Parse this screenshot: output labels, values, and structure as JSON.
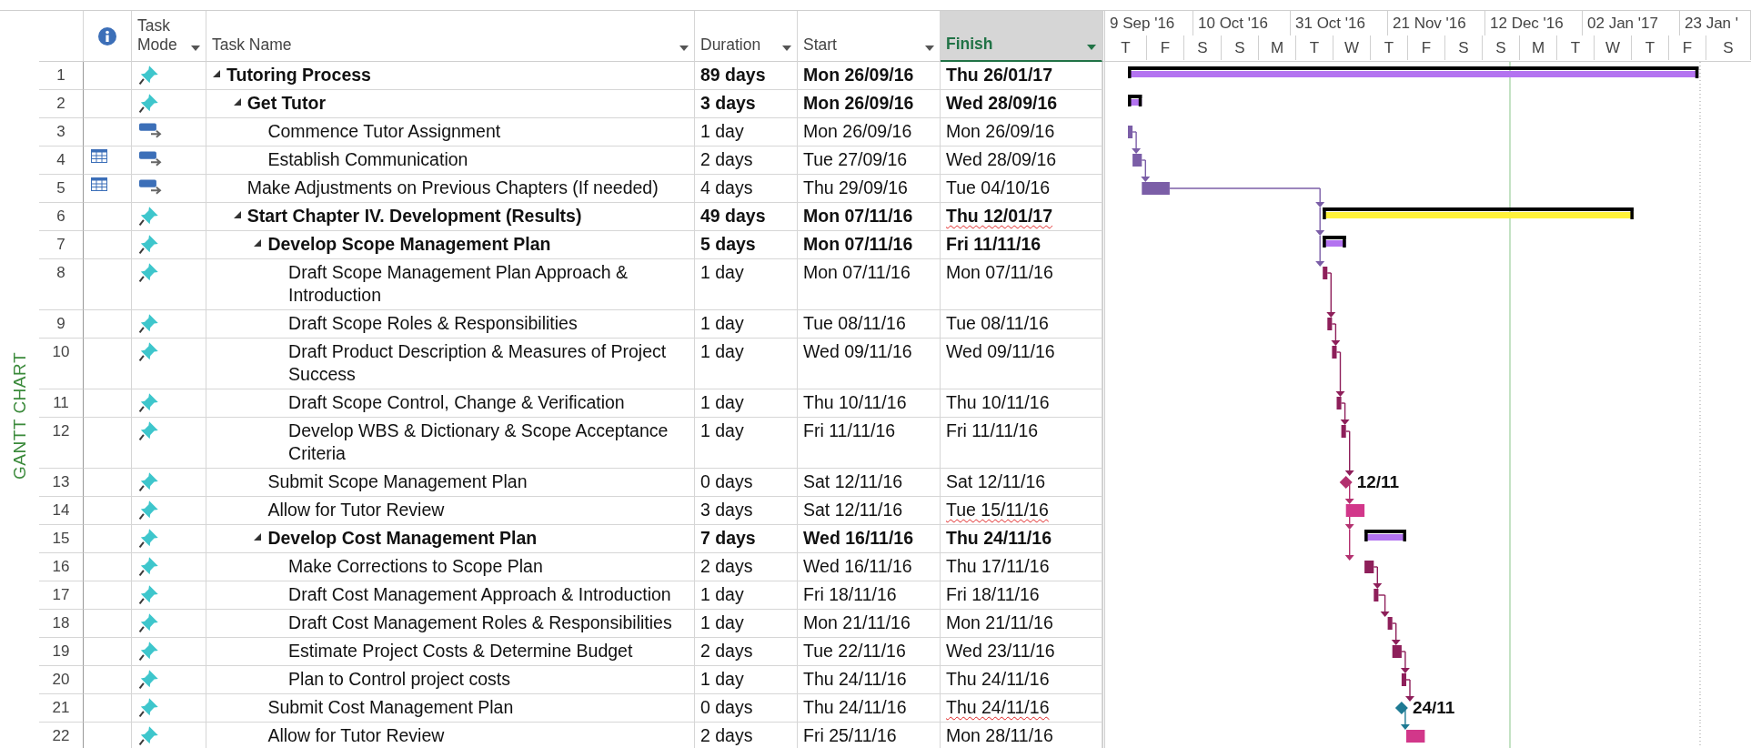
{
  "side_label": "GANTT CHART",
  "columns": [
    {
      "kind": "id",
      "selected": false
    },
    {
      "kind": "info",
      "selected": false
    },
    {
      "kind": "mode",
      "label": "Task Mode",
      "selected": false
    },
    {
      "kind": "name",
      "label": "Task Name",
      "selected": false
    },
    {
      "kind": "duration",
      "label": "Duration",
      "selected": false
    },
    {
      "kind": "start",
      "label": "Start",
      "selected": false
    },
    {
      "kind": "finish",
      "label": "Finish",
      "selected": true
    }
  ],
  "timescale": {
    "major": [
      "9 Sep '16",
      "10 Oct '16",
      "31 Oct '16",
      "21 Nov '16",
      "12 Dec '16",
      "02 Jan '17",
      "23 Jan '"
    ],
    "minor": [
      "T",
      "F",
      "S",
      "S",
      "M",
      "T",
      "W",
      "T",
      "F",
      "S",
      "S",
      "M",
      "T",
      "W",
      "T",
      "F",
      "S"
    ]
  },
  "tasks": [
    {
      "id": "1",
      "name": "Tutoring Process",
      "duration": "89 days",
      "start": "Mon 26/09/16",
      "finish": "Thu 26/01/17",
      "kind": "summary",
      "manual": true,
      "calendar": false,
      "expanded": true,
      "finish_flagged": false,
      "color": "#b373f0",
      "link_in": false,
      "link_out": false,
      "children": [
        {
          "id": "2",
          "name": "Get Tutor",
          "duration": "3 days",
          "start": "Mon 26/09/16",
          "finish": "Wed 28/09/16",
          "kind": "summary",
          "manual": true,
          "calendar": false,
          "expanded": true,
          "finish_flagged": false,
          "color": "#b373f0",
          "link_in": false,
          "link_out": false,
          "children": [
            {
              "id": "3",
              "name": "Commence Tutor Assignment",
              "duration": "1 day",
              "start": "Mon 26/09/16",
              "finish": "Mon 26/09/16",
              "kind": "task",
              "manual": false,
              "calendar": false,
              "finish_flagged": false,
              "color": "#7b5ea7",
              "link_in": false,
              "link_out": true
            },
            {
              "id": "4",
              "name": "Establish Communication",
              "duration": "2 days",
              "start": "Tue 27/09/16",
              "finish": "Wed 28/09/16",
              "kind": "task",
              "manual": false,
              "calendar": true,
              "finish_flagged": false,
              "color": "#7b5ea7",
              "link_in": true,
              "link_out": true
            }
          ]
        },
        {
          "id": "5",
          "name": "Make Adjustments on Previous Chapters (If needed)",
          "duration": "4 days",
          "start": "Thu 29/09/16",
          "finish": "Tue 04/10/16",
          "kind": "task",
          "manual": false,
          "calendar": true,
          "finish_flagged": false,
          "color": "#7b5ea7",
          "link_in": true,
          "link_out": true
        },
        {
          "id": "6",
          "name": "Start Chapter IV. Development (Results)",
          "duration": "49 days",
          "start": "Mon 07/11/16",
          "finish": "Thu 12/01/17",
          "kind": "summary",
          "manual": true,
          "calendar": false,
          "expanded": true,
          "finish_flagged": true,
          "color": "#fff23a",
          "link_in": true,
          "link_out": false,
          "children": [
            {
              "id": "7",
              "name": "Develop Scope Management Plan",
              "duration": "5 days",
              "start": "Mon 07/11/16",
              "finish": "Fri 11/11/16",
              "kind": "summary",
              "manual": true,
              "calendar": false,
              "expanded": true,
              "finish_flagged": false,
              "color": "#b373f0",
              "link_in": true,
              "link_out": false,
              "children": [
                {
                  "id": "8",
                  "name": "Draft Scope Management Plan Approach & Introduction",
                  "duration": "1 day",
                  "start": "Mon 07/11/16",
                  "finish": "Mon 07/11/16",
                  "kind": "task",
                  "manual": true,
                  "calendar": false,
                  "finish_flagged": false,
                  "color": "#8e1f5a",
                  "link_in": true,
                  "link_out": true
                },
                {
                  "id": "9",
                  "name": "Draft Scope Roles & Responsibilities",
                  "duration": "1 day",
                  "start": "Tue 08/11/16",
                  "finish": "Tue 08/11/16",
                  "kind": "task",
                  "manual": true,
                  "calendar": false,
                  "finish_flagged": false,
                  "color": "#8e1f5a",
                  "link_in": true,
                  "link_out": true
                },
                {
                  "id": "10",
                  "name": "Draft Product Description & Measures of Project Success",
                  "duration": "1 day",
                  "start": "Wed 09/11/16",
                  "finish": "Wed 09/11/16",
                  "kind": "task",
                  "manual": true,
                  "calendar": false,
                  "finish_flagged": false,
                  "color": "#8e1f5a",
                  "link_in": true,
                  "link_out": true
                },
                {
                  "id": "11",
                  "name": "Draft Scope Control, Change & Verification",
                  "duration": "1 day",
                  "start": "Thu 10/11/16",
                  "finish": "Thu 10/11/16",
                  "kind": "task",
                  "manual": true,
                  "calendar": false,
                  "finish_flagged": false,
                  "color": "#8e1f5a",
                  "link_in": true,
                  "link_out": true
                },
                {
                  "id": "12",
                  "name": "Develop WBS & Dictionary & Scope Acceptance Criteria",
                  "duration": "1 day",
                  "start": "Fri 11/11/16",
                  "finish": "Fri 11/11/16",
                  "kind": "task",
                  "manual": true,
                  "calendar": false,
                  "finish_flagged": false,
                  "color": "#8e1f5a",
                  "link_in": true,
                  "link_out": true
                }
              ]
            },
            {
              "id": "13",
              "name": "Submit Scope Management Plan",
              "duration": "0 days",
              "start": "Sat 12/11/16",
              "finish": "Sat 12/11/16",
              "kind": "milestone",
              "manual": true,
              "calendar": false,
              "finish_flagged": false,
              "color": "#b3306f",
              "link_in": true,
              "link_out": true,
              "milestone_label": "12/11"
            },
            {
              "id": "14",
              "name": "Allow for Tutor Review",
              "duration": "3 days",
              "start": "Sat 12/11/16",
              "finish": "Tue 15/11/16",
              "kind": "task",
              "manual": true,
              "calendar": false,
              "finish_flagged": true,
              "color": "#d2378a",
              "link_in": true,
              "link_out": false
            },
            {
              "id": "15",
              "name": "Develop Cost Management Plan",
              "duration": "7 days",
              "start": "Wed 16/11/16",
              "finish": "Thu 24/11/16",
              "kind": "summary",
              "manual": true,
              "calendar": false,
              "expanded": true,
              "finish_flagged": false,
              "color": "#b373f0",
              "link_in": true,
              "link_out": false,
              "children": [
                {
                  "id": "16",
                  "name": "Make Corrections to Scope Plan",
                  "duration": "2 days",
                  "start": "Wed 16/11/16",
                  "finish": "Thu 17/11/16",
                  "kind": "task",
                  "manual": true,
                  "calendar": false,
                  "finish_flagged": false,
                  "color": "#8e1f5a",
                  "link_in": true,
                  "link_out": true
                },
                {
                  "id": "17",
                  "name": "Draft Cost Management Approach & Introduction",
                  "duration": "1 day",
                  "start": "Fri 18/11/16",
                  "finish": "Fri 18/11/16",
                  "kind": "task",
                  "manual": true,
                  "calendar": false,
                  "finish_flagged": false,
                  "color": "#8e1f5a",
                  "link_in": true,
                  "link_out": true
                },
                {
                  "id": "18",
                  "name": "Draft Cost Management Roles & Responsibilities",
                  "duration": "1 day",
                  "start": "Mon 21/11/16",
                  "finish": "Mon 21/11/16",
                  "kind": "task",
                  "manual": true,
                  "calendar": false,
                  "finish_flagged": false,
                  "color": "#8e1f5a",
                  "link_in": true,
                  "link_out": true
                },
                {
                  "id": "19",
                  "name": "Estimate Project Costs & Determine Budget",
                  "duration": "2 days",
                  "start": "Tue 22/11/16",
                  "finish": "Wed 23/11/16",
                  "kind": "task",
                  "manual": true,
                  "calendar": false,
                  "finish_flagged": false,
                  "color": "#8e1f5a",
                  "link_in": true,
                  "link_out": true
                },
                {
                  "id": "20",
                  "name": "Plan to Control project costs",
                  "duration": "1 day",
                  "start": "Thu 24/11/16",
                  "finish": "Thu 24/11/16",
                  "kind": "task",
                  "manual": true,
                  "calendar": false,
                  "finish_flagged": false,
                  "color": "#8e1f5a",
                  "link_in": true,
                  "link_out": true
                }
              ]
            },
            {
              "id": "21",
              "name": "Submit Cost Management Plan",
              "duration": "0 days",
              "start": "Thu 24/11/16",
              "finish": "Thu 24/11/16",
              "kind": "milestone",
              "manual": true,
              "calendar": false,
              "finish_flagged": true,
              "color": "#1e7a93",
              "link_in": true,
              "link_out": true,
              "milestone_label": "24/11"
            },
            {
              "id": "22",
              "name": "Allow for Tutor Review",
              "duration": "2 days",
              "start": "Fri 25/11/16",
              "finish": "Mon 28/11/16",
              "kind": "task",
              "manual": true,
              "calendar": false,
              "finish_flagged": false,
              "color": "#d2378a",
              "link_in": true,
              "link_out": false
            }
          ]
        }
      ]
    }
  ]
}
